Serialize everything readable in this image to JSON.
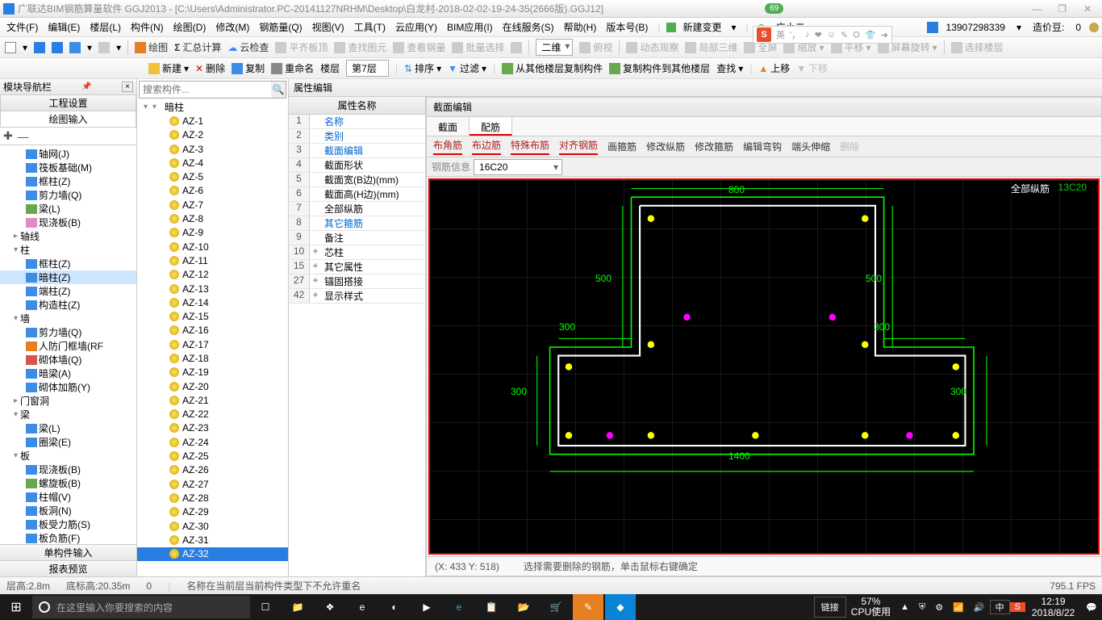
{
  "title": "广联达BIM钢筋算量软件 GGJ2013 - [C:\\Users\\Administrator.PC-20141127NRHM\\Desktop\\白龙村-2018-02-02-19-24-35(2666版).GGJ12]",
  "badge": "69",
  "menus": [
    "文件(F)",
    "编辑(E)",
    "楼层(L)",
    "构件(N)",
    "绘图(D)",
    "修改(M)",
    "钢筋量(Q)",
    "视图(V)",
    "工具(T)",
    "云应用(Y)",
    "BIM应用(I)",
    "在线服务(S)",
    "帮助(H)",
    "版本号(B)"
  ],
  "menu_right": {
    "new_change": "新建变更",
    "user": "广小二",
    "phone": "13907298339",
    "budget_label": "造价豆:",
    "budget": "0"
  },
  "sogou": {
    "lang": "英",
    "hint1": "♪",
    "hint2": "❤",
    "hint3": "☺",
    "hint4": "✎",
    "hint5": "⛭",
    "hint6": "👕",
    "hint7": "➜"
  },
  "tb1": {
    "draw": "绘图",
    "sum": "汇总计算",
    "check": "云检查",
    "flat": "平齐板顶",
    "findmap": "查找图元",
    "viewsteel": "查看钢量",
    "batch": "批量选择",
    "dim": "二维",
    "bird": "俯视",
    "dyn": "动态观察",
    "local3d": "局部三维",
    "full": "全屏",
    "zoom": "缩放",
    "pan": "平移",
    "rot": "屏幕旋转",
    "selfloor": "选择楼层"
  },
  "tb2": {
    "new": "新建",
    "del": "删除",
    "copy": "复制",
    "rename": "重命名",
    "floor": "楼层",
    "floor_val": "第7层",
    "sort": "排序",
    "filter": "过滤",
    "copyfrom": "从其他楼层复制构件",
    "copyto": "复制构件到其他楼层",
    "find": "查找",
    "up": "上移",
    "down": "下移"
  },
  "nav": {
    "title": "模块导航栏",
    "tab1": "工程设置",
    "tab2": "绘图输入",
    "tree": [
      {
        "pad": 30,
        "ic": "blu",
        "t": "轴网(J)"
      },
      {
        "pad": 30,
        "ic": "blu",
        "t": "筏板基础(M)"
      },
      {
        "pad": 30,
        "ic": "blu",
        "t": "框柱(Z)"
      },
      {
        "pad": 30,
        "ic": "blu",
        "t": "剪力墙(Q)"
      },
      {
        "pad": 30,
        "ic": "grn",
        "t": "梁(L)"
      },
      {
        "pad": 30,
        "ic": "pnk",
        "t": "现浇板(B)"
      },
      {
        "pad": 14,
        "tw": "▸",
        "ic": "",
        "t": "轴线"
      },
      {
        "pad": 14,
        "tw": "▾",
        "ic": "",
        "t": "柱"
      },
      {
        "pad": 30,
        "ic": "blu",
        "t": "框柱(Z)"
      },
      {
        "pad": 30,
        "ic": "blu",
        "t": "暗柱(Z)",
        "sel": true
      },
      {
        "pad": 30,
        "ic": "blu",
        "t": "端柱(Z)"
      },
      {
        "pad": 30,
        "ic": "blu",
        "t": "构造柱(Z)"
      },
      {
        "pad": 14,
        "tw": "▾",
        "ic": "",
        "t": "墙"
      },
      {
        "pad": 30,
        "ic": "blu",
        "t": "剪力墙(Q)"
      },
      {
        "pad": 30,
        "ic": "org",
        "t": "人防门框墙(RF"
      },
      {
        "pad": 30,
        "ic": "red",
        "t": "砌体墙(Q)"
      },
      {
        "pad": 30,
        "ic": "blu",
        "t": "暗梁(A)"
      },
      {
        "pad": 30,
        "ic": "blu",
        "t": "砌体加筋(Y)"
      },
      {
        "pad": 14,
        "tw": "▸",
        "ic": "",
        "t": "门窗洞"
      },
      {
        "pad": 14,
        "tw": "▾",
        "ic": "",
        "t": "梁"
      },
      {
        "pad": 30,
        "ic": "blu",
        "t": "梁(L)"
      },
      {
        "pad": 30,
        "ic": "blu",
        "t": "圈梁(E)"
      },
      {
        "pad": 14,
        "tw": "▾",
        "ic": "",
        "t": "板"
      },
      {
        "pad": 30,
        "ic": "blu",
        "t": "现浇板(B)"
      },
      {
        "pad": 30,
        "ic": "grn",
        "t": "螺旋板(B)"
      },
      {
        "pad": 30,
        "ic": "blu",
        "t": "柱帽(V)"
      },
      {
        "pad": 30,
        "ic": "blu",
        "t": "板洞(N)"
      },
      {
        "pad": 30,
        "ic": "blu",
        "t": "板受力筋(S)"
      },
      {
        "pad": 30,
        "ic": "blu",
        "t": "板负筋(F)"
      }
    ],
    "bt1": "单构件输入",
    "bt2": "报表预览"
  },
  "search_placeholder": "搜索构件...",
  "list_hdr": "暗柱",
  "list": [
    "AZ-1",
    "AZ-2",
    "AZ-3",
    "AZ-4",
    "AZ-5",
    "AZ-6",
    "AZ-7",
    "AZ-8",
    "AZ-9",
    "AZ-10",
    "AZ-11",
    "AZ-12",
    "AZ-13",
    "AZ-14",
    "AZ-15",
    "AZ-16",
    "AZ-17",
    "AZ-18",
    "AZ-19",
    "AZ-20",
    "AZ-21",
    "AZ-22",
    "AZ-23",
    "AZ-24",
    "AZ-25",
    "AZ-26",
    "AZ-27",
    "AZ-28",
    "AZ-29",
    "AZ-30",
    "AZ-31",
    "AZ-32"
  ],
  "list_sel": "AZ-32",
  "prop_title": "属性编辑",
  "prop_hdr": "属性名称",
  "props": [
    {
      "n": "1",
      "t": "名称",
      "c": "blue"
    },
    {
      "n": "2",
      "t": "类别",
      "c": "blue"
    },
    {
      "n": "3",
      "t": "截面编辑",
      "c": "blue"
    },
    {
      "n": "4",
      "t": "截面形状"
    },
    {
      "n": "5",
      "t": "截面宽(B边)(mm)"
    },
    {
      "n": "6",
      "t": "截面高(H边)(mm)"
    },
    {
      "n": "7",
      "t": "全部纵筋"
    },
    {
      "n": "8",
      "t": "其它箍筋",
      "c": "blue"
    },
    {
      "n": "9",
      "t": "备注"
    },
    {
      "n": "10",
      "t": "芯柱",
      "exp": "+"
    },
    {
      "n": "15",
      "t": "其它属性",
      "exp": "+"
    },
    {
      "n": "27",
      "t": "锚固搭接",
      "exp": "+"
    },
    {
      "n": "42",
      "t": "显示样式",
      "exp": "+"
    }
  ],
  "editor": {
    "title": "截面编辑",
    "tabs": [
      "截面",
      "配筋"
    ],
    "active_tab": "配筋",
    "cmds": [
      {
        "t": "布角筋",
        "a": true
      },
      {
        "t": "布边筋",
        "a": true
      },
      {
        "t": "特殊布筋",
        "a": true
      },
      {
        "t": "对齐钢筋",
        "a": true
      },
      {
        "t": "画箍筋"
      },
      {
        "t": "修改纵筋"
      },
      {
        "t": "修改箍筋"
      },
      {
        "t": "编辑弯钩"
      },
      {
        "t": "端头伸缩"
      },
      {
        "t": "删除",
        "dim": true
      }
    ],
    "rebar_lbl": "钢筋信息",
    "rebar_val": "16C20",
    "dims": {
      "d800": "800",
      "d500a": "500",
      "d500b": "500",
      "d300a": "300",
      "d300b": "300",
      "d300c": "300",
      "d300d": "300",
      "d1400": "1400"
    },
    "ann": "全部纵筋",
    "ann2": "13C20",
    "status_xy": "(X: 433 Y: 518)",
    "status_hint": "选择需要删除的钢筋，单击鼠标右键确定"
  },
  "status": {
    "floor": "层高:2.8m",
    "bottom": "底标高:20.35m",
    "o": "0",
    "msg": "名称在当前层当前构件类型下不允许重名",
    "fps": "795.1 FPS"
  },
  "taskbar": {
    "search": "在这里输入你要搜索的内容",
    "link": "链接",
    "cpu1": "57%",
    "cpu2": "CPU使用",
    "time": "12:19",
    "date": "2018/8/22",
    "ime": "中"
  }
}
